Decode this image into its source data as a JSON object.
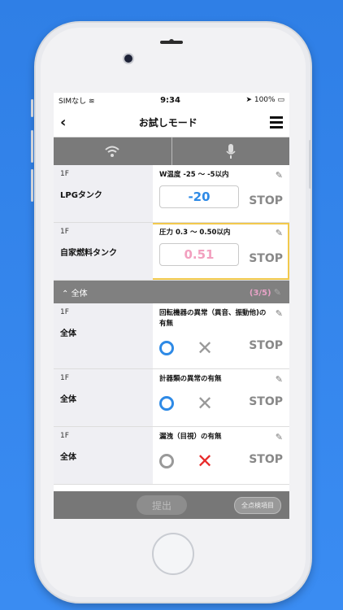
{
  "status": {
    "carrier": "SIMなし",
    "time": "9:34",
    "battery": "100%"
  },
  "nav": {
    "title": "お試しモード"
  },
  "rows_top": [
    {
      "floor": "1F",
      "name": "LPGタンク",
      "title": "W温度 -25 ～ -5以内",
      "value": "-20",
      "value_color": "#2e8ae6",
      "stop": "STOP"
    },
    {
      "floor": "1F",
      "name": "自家燃料タンク",
      "title": "圧力 0.3 ～ 0.50以内",
      "value": "0.51",
      "value_color": "#f2a0bf",
      "stop": "STOP",
      "highlight": "#f2c94c"
    }
  ],
  "section": {
    "label": "全体",
    "count": "(3/5)"
  },
  "rows_check": [
    {
      "floor": "1F",
      "name": "全体",
      "title": "回転機器の異常（異音、振動他)の有無",
      "stop": "STOP"
    },
    {
      "floor": "1F",
      "name": "全体",
      "title": "計器類の異常の有無",
      "stop": "STOP"
    },
    {
      "floor": "1F",
      "name": "全体",
      "title": "漏洩（目視）の有無",
      "stop": "STOP"
    }
  ],
  "footer": {
    "submit": "提出",
    "all": "全点検項目"
  }
}
